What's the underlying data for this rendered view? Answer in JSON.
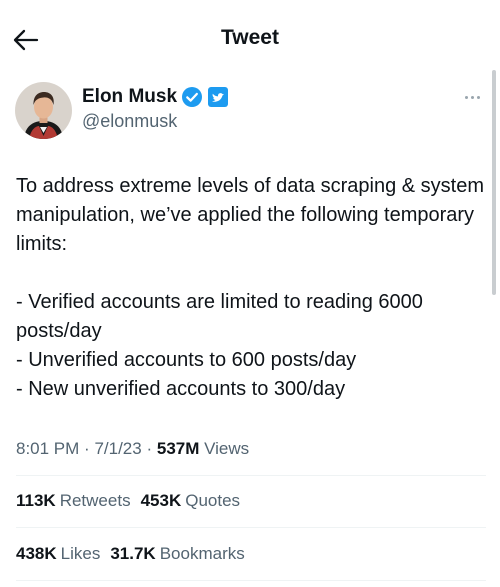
{
  "header": {
    "title": "Tweet"
  },
  "author": {
    "name": "Elon Musk",
    "handle": "@elonmusk"
  },
  "tweet": {
    "text": "To address extreme levels of data scraping & system manipulation, we’ve applied the following temporary limits:\n\n- Verified accounts are limited to reading 6000 posts/day\n- Unverified accounts to 600 posts/day\n- New unverified accounts to 300/day"
  },
  "meta": {
    "time": "8:01 PM",
    "sep": "·",
    "date": "7/1/23",
    "views_count": "537M",
    "views_label": "Views"
  },
  "stats": {
    "retweets_count": "113K",
    "retweets_label": "Retweets",
    "quotes_count": "453K",
    "quotes_label": "Quotes",
    "likes_count": "438K",
    "likes_label": "Likes",
    "bookmarks_count": "31.7K",
    "bookmarks_label": "Bookmarks"
  },
  "colors": {
    "accent": "#1d9bf0",
    "secondary_text": "#536471",
    "divider": "#eff3f4"
  },
  "icons": {
    "back": "arrow-left-icon",
    "verified": "verified-badge-icon",
    "more": "more-icon"
  }
}
